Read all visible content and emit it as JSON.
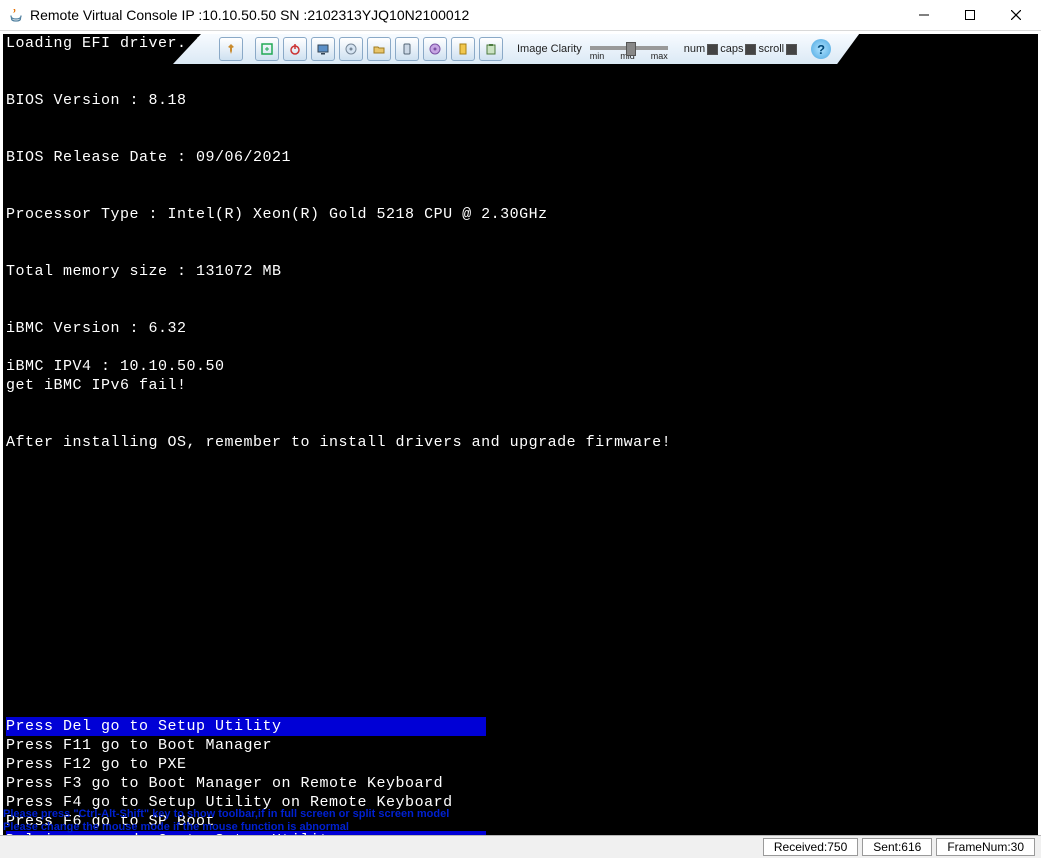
{
  "window": {
    "title": "Remote Virtual Console   IP :10.10.50.50   SN :2102313YJQ10N2100012"
  },
  "toolbar": {
    "clarity_label": "Image Clarity",
    "clarity_ticks": {
      "min": "min",
      "mid": "mid",
      "max": "max"
    },
    "indicators": {
      "num": "num",
      "caps": "caps",
      "scroll": "scroll"
    }
  },
  "boot": {
    "loading": "Loading EFI driver. It",
    "bios_version": "BIOS Version : 8.18",
    "bios_date": "BIOS Release Date : 09/06/2021",
    "cpu": "Processor Type : Intel(R) Xeon(R) Gold 5218 CPU @ 2.30GHz",
    "mem": "Total memory size : 131072 MB",
    "ibmc_ver": "iBMC Version : 6.32",
    "ibmc_ip": "iBMC IPV4 : 10.10.50.50",
    "ibmc_ipv6": "get iBMC IPv6 fail!",
    "reminder": "After installing OS, remember to install drivers and upgrade firmware!",
    "menu": {
      "del": "Press Del go to Setup Utility",
      "f11": "Press F11 go to Boot Manager",
      "f12": "Press F12 go to PXE",
      "f3": "Press F3 go to Boot Manager on Remote Keyboard",
      "f4": "Press F4 go to Setup Utility on Remote Keyboard",
      "f6": "Press F6 go to SP Boot",
      "pressed": "Del is pressed. Go to Setup Utility."
    }
  },
  "hints": {
    "line1": "Please press \"Ctrl-Alt-Shift\" key to show toolbar,if in full screen or split screen model",
    "line2": "Please change the mouse mode if the mouse function is abnormal"
  },
  "status": {
    "received": "Received:750",
    "sent": "Sent:616",
    "frame": "FrameNum:30"
  }
}
